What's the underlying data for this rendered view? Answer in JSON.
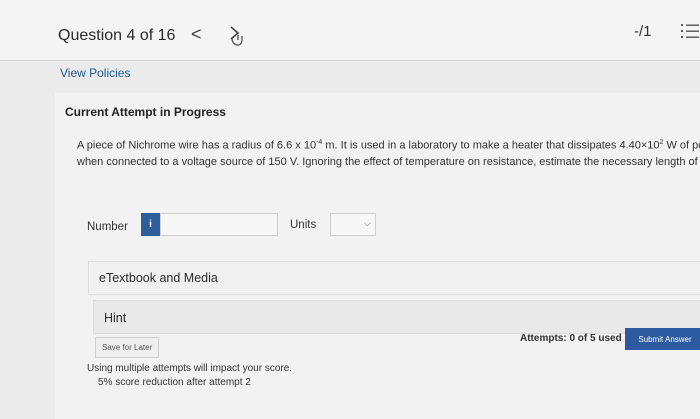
{
  "header": {
    "question_label": "Question 4 of 16",
    "prev_glyph": "<",
    "score": "-/1"
  },
  "policies_link": "View Policies",
  "attempt_heading": "Current Attempt in Progress",
  "question": {
    "part1": "A piece of Nichrome wire has a radius of 6.6 x 10",
    "exp1": "-4",
    "part2": " m. It is used in a laboratory to make a heater that dissipates 4.40×10",
    "exp2": "2",
    "part3": " W of power",
    "line2": "when connected to a voltage source of 150 V. Ignoring the effect of temperature on resistance, estimate the necessary length of wire."
  },
  "answer": {
    "number_label": "Number",
    "info_glyph": "i",
    "number_value": "",
    "units_label": "Units",
    "units_selected": ""
  },
  "resources": {
    "etextbook": "eTextbook and Media",
    "hint": "Hint"
  },
  "footer": {
    "save_label": "Save for Later",
    "attempts_label": "Attempts:",
    "attempts_value": "0 of 5 used",
    "submit_label": "Submit Answer",
    "warning_line1": "Using multiple attempts will impact your score.",
    "warning_line2": "5% score reduction after attempt 2"
  }
}
